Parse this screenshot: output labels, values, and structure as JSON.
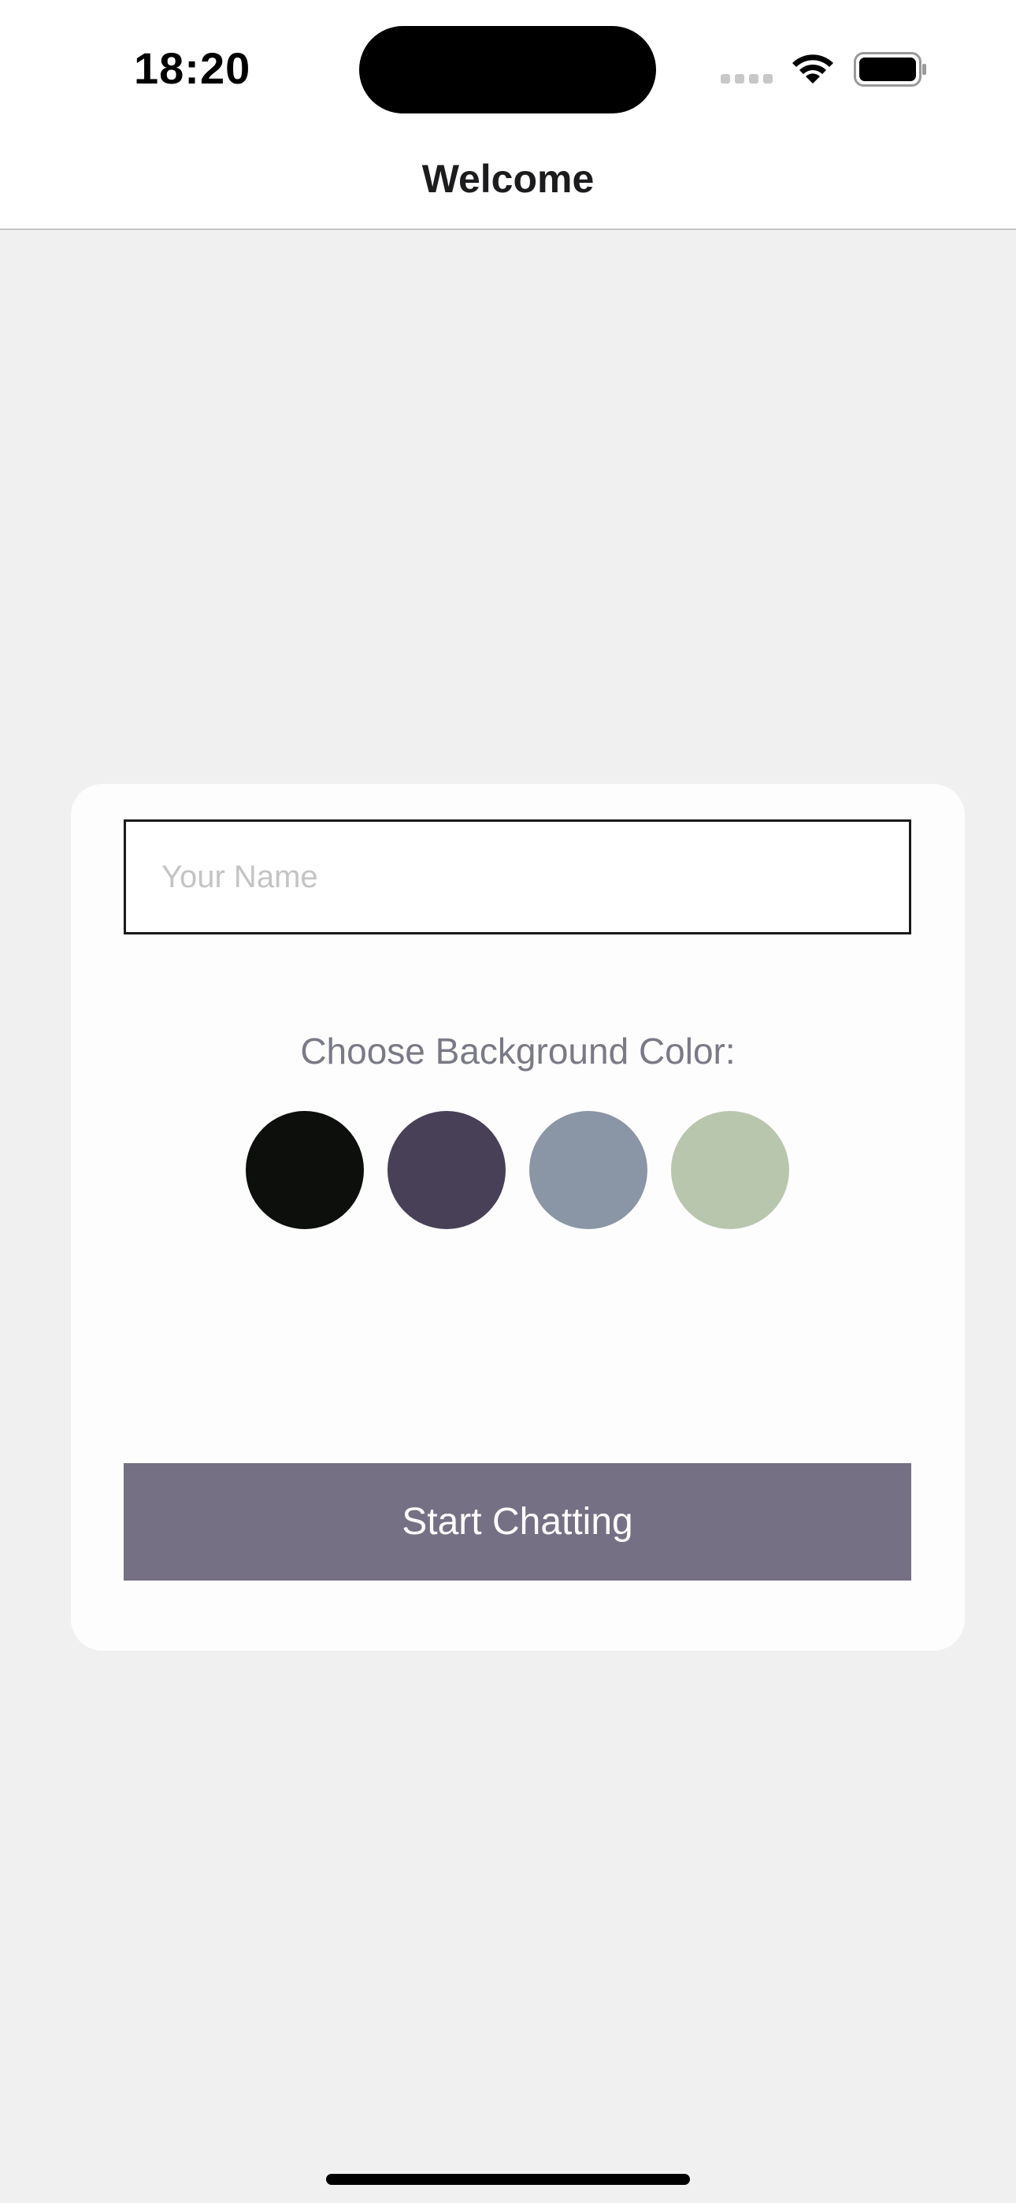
{
  "status_bar": {
    "time": "18:20",
    "icons": [
      "cellular-signal-icon",
      "wifi-icon",
      "battery-icon"
    ]
  },
  "nav": {
    "title": "Welcome"
  },
  "form": {
    "name_placeholder": "Your Name",
    "name_value": "",
    "color_label": "Choose Background Color:",
    "colors": [
      "#0d0f0c",
      "#474056",
      "#8a95a5",
      "#b9c6ae"
    ],
    "start_label": "Start Chatting",
    "button_color": "#757083"
  }
}
